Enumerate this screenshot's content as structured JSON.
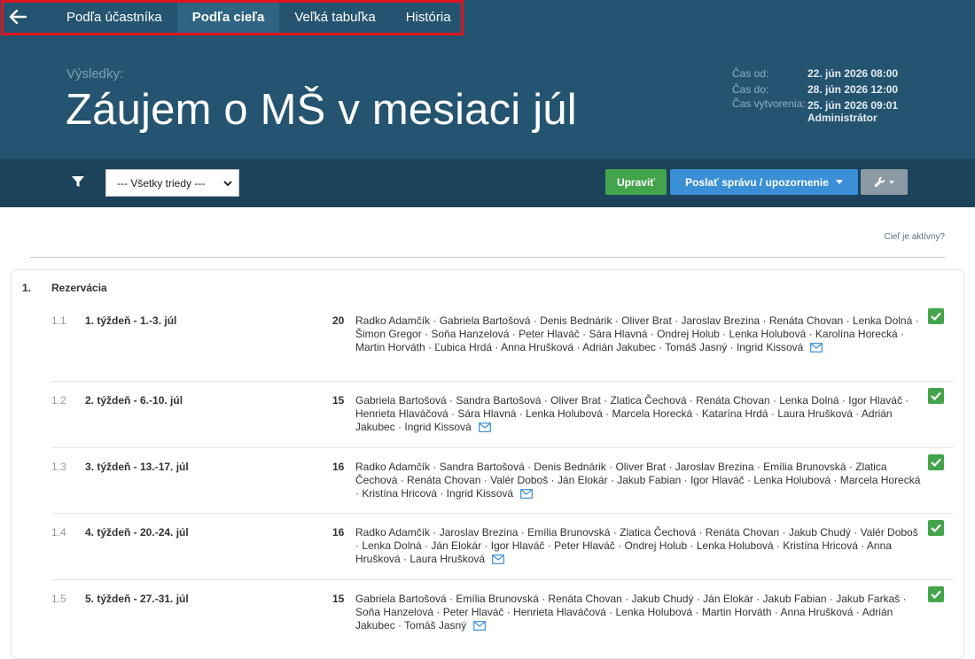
{
  "nav": {
    "back_label": "",
    "tabs": [
      {
        "label": "Podľa účastníka",
        "active": false
      },
      {
        "label": "Podľa cieľa",
        "active": true
      },
      {
        "label": "Veľká tabuľka",
        "active": false
      },
      {
        "label": "História",
        "active": false
      }
    ]
  },
  "header": {
    "overline": "Výsledky:",
    "title": "Záujem o MŠ v mesiaci júl",
    "meta": [
      {
        "key": "Čas od:",
        "value": "22. jún 2026 08:00"
      },
      {
        "key": "Čas do:",
        "value": "28. jún 2026 12:00"
      },
      {
        "key": "Čas vytvorenia:",
        "value": "25. jún 2026 09:01"
      },
      {
        "key": "",
        "value": "Administrátor"
      }
    ]
  },
  "toolbar": {
    "filter_icon": "filter-icon",
    "class_select": "--- Všetky triedy ---",
    "edit_label": "Upraviť",
    "send_label": "Poslať správu / upozornenie",
    "tools_icon": "wrench-icon"
  },
  "active_link": "Cieľ je aktívny?",
  "colors": {
    "hero": "#245470",
    "toolbar": "#1c435b",
    "success": "#44a44c",
    "primary": "#3b8fd6",
    "highlight": "#e0141e"
  },
  "section": {
    "number": "1.",
    "title": "Rezervácia",
    "goals": [
      {
        "number": "1.1",
        "name": "1. týždeň - 1.-3. júl",
        "count": "20",
        "people": "Radko Adamčík · Gabriela Bartošová · Denis Bednárik · Oliver Brat · Jaroslav Brezina · Renáta Chovan · Lenka Dolná · Šimon Gregor · Soňa Hanzelová · Peter Hlaváč · Sára Hlavná · Ondrej Holub · Lenka Holubová · Karolína Horecká · Martin Horváth · Ľubica Hrdá · Anna Hrušková · Adrián Jakubec · Tomáš Jasný · Ingrid Kissová",
        "checked": true
      },
      {
        "number": "1.2",
        "name": "2. týždeň - 6.-10. júl",
        "count": "15",
        "people": "Gabriela Bartošová · Sandra Bartošová · Oliver Brat · Zlatica Čechová · Renáta Chovan · Lenka Dolná · Igor Hlaváč · Henrieta Hlaváčová · Sára Hlavná · Lenka Holubová · Marcela Horecká · Katarína Hrdá · Laura Hrušková · Adrián Jakubec · Ingrid Kissová",
        "checked": true
      },
      {
        "number": "1.3",
        "name": "3. týždeň - 13.-17. júl",
        "count": "16",
        "people": "Radko Adamčík · Sandra Bartošová · Denis Bednárik · Oliver Brat · Jaroslav Brezina · Emília Brunovská · Zlatica Čechová · Renáta Chovan · Valér Doboš · Ján Elokár · Jakub Fabian · Igor Hlaváč · Lenka Holubová · Marcela Horecká · Kristína Hricová · Ingrid Kissová",
        "checked": true
      },
      {
        "number": "1.4",
        "name": "4. týždeň - 20.-24. júl",
        "count": "16",
        "people": "Radko Adamčík · Jaroslav Brezina · Emília Brunovská · Zlatica Čechová · Renáta Chovan · Jakub Chudý · Valér Doboš · Lenka Dolná · Ján Elokár · Igor Hlaváč · Peter Hlaváč · Ondrej Holub · Lenka Holubová · Kristína Hricová · Anna Hrušková · Laura Hrušková",
        "checked": true
      },
      {
        "number": "1.5",
        "name": "5. týždeň - 27.-31. júl",
        "count": "15",
        "people": "Gabriela Bartošová · Emília Brunovská · Renáta Chovan · Jakub Chudý · Ján Elokár · Jakub Fabian · Jakub Farkaš · Soňa Hanzelová · Peter Hlaváč · Henrieta Hlaváčová · Lenka Holubová · Martin Horváth · Anna Hrušková · Adrián Jakubec · Tomáš Jasný",
        "checked": true
      }
    ]
  }
}
